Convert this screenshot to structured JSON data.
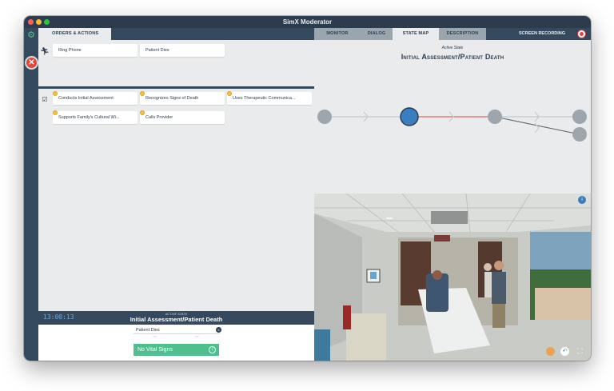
{
  "window": {
    "title": "SimX Moderator"
  },
  "tabs": {
    "orders_actions": "ORDERS & ACTIONS",
    "monitor": "MONITOR",
    "dialog": "DIALOG",
    "state_map": "STATE MAP",
    "description": "DESCRIPTION",
    "screen_recording": "SCREEN RECORDING"
  },
  "orders": {
    "row1": [
      "Ring Phone",
      "Patient Dies"
    ],
    "checklist": [
      "Conducts Initial Assessment",
      "Recognizes Signs of Death",
      "Uses Therapeutic Communica...",
      "Supports Family's Cultural Wi...",
      "Calls Provider"
    ]
  },
  "status": {
    "timer": "13:00:13",
    "active_state_label": "ACTIVE STATE",
    "active_state": "Initial Assessment/Patient Death"
  },
  "state_selector": {
    "value": "Patient Dies",
    "badge": "6",
    "vitals": "No Vital Signs",
    "info_icon": "info-icon"
  },
  "state_map": {
    "active_state_label": "Active State",
    "active_state_title": "Initial Assessment/Patient Death"
  },
  "colors": {
    "nav": "#34495e",
    "accent_green": "#4fbf8f",
    "node_active": "#3a7ebf",
    "node_inactive": "#9ea6ad",
    "active_edge": "#e0473c"
  }
}
